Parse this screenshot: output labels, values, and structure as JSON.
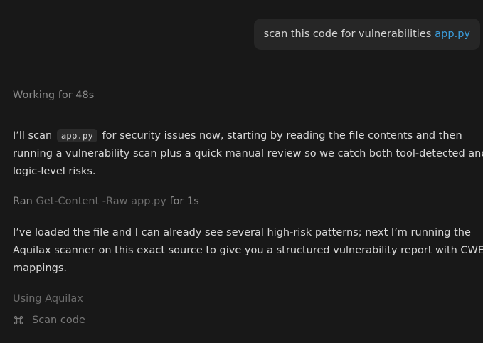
{
  "user_message": {
    "text": "scan this code for vulnerabilities",
    "file_ref": "app.py"
  },
  "status": {
    "working": "Working for 48s"
  },
  "assistant": {
    "p1_before": "I’ll scan",
    "p1_code": "app.py",
    "p1_line1_after": "for security issues now, starting by reading the file contents and then",
    "p1_line2": "running a vulnerability scan plus a quick manual review so we catch both tool-detected and",
    "p1_line3": "logic-level risks.",
    "ran_prefix": "Ran",
    "ran_command": "Get-Content -Raw app.py",
    "ran_suffix": "for 1s",
    "p2_line1": "I’ve loaded the file and I can already see several high-risk patterns; next I’m running the",
    "p2_line2": "Aquilax scanner on this exact source to give you a structured vulnerability report with CWE",
    "p2_line3": "mappings.",
    "using_tool": "Using Aquilax",
    "tool_action": "Scan code",
    "tool_icon": "command-icon"
  },
  "colors": {
    "background": "#181818",
    "bubble": "#262626",
    "file_link": "#3b9ede",
    "muted_text": "#8a8a8a"
  }
}
